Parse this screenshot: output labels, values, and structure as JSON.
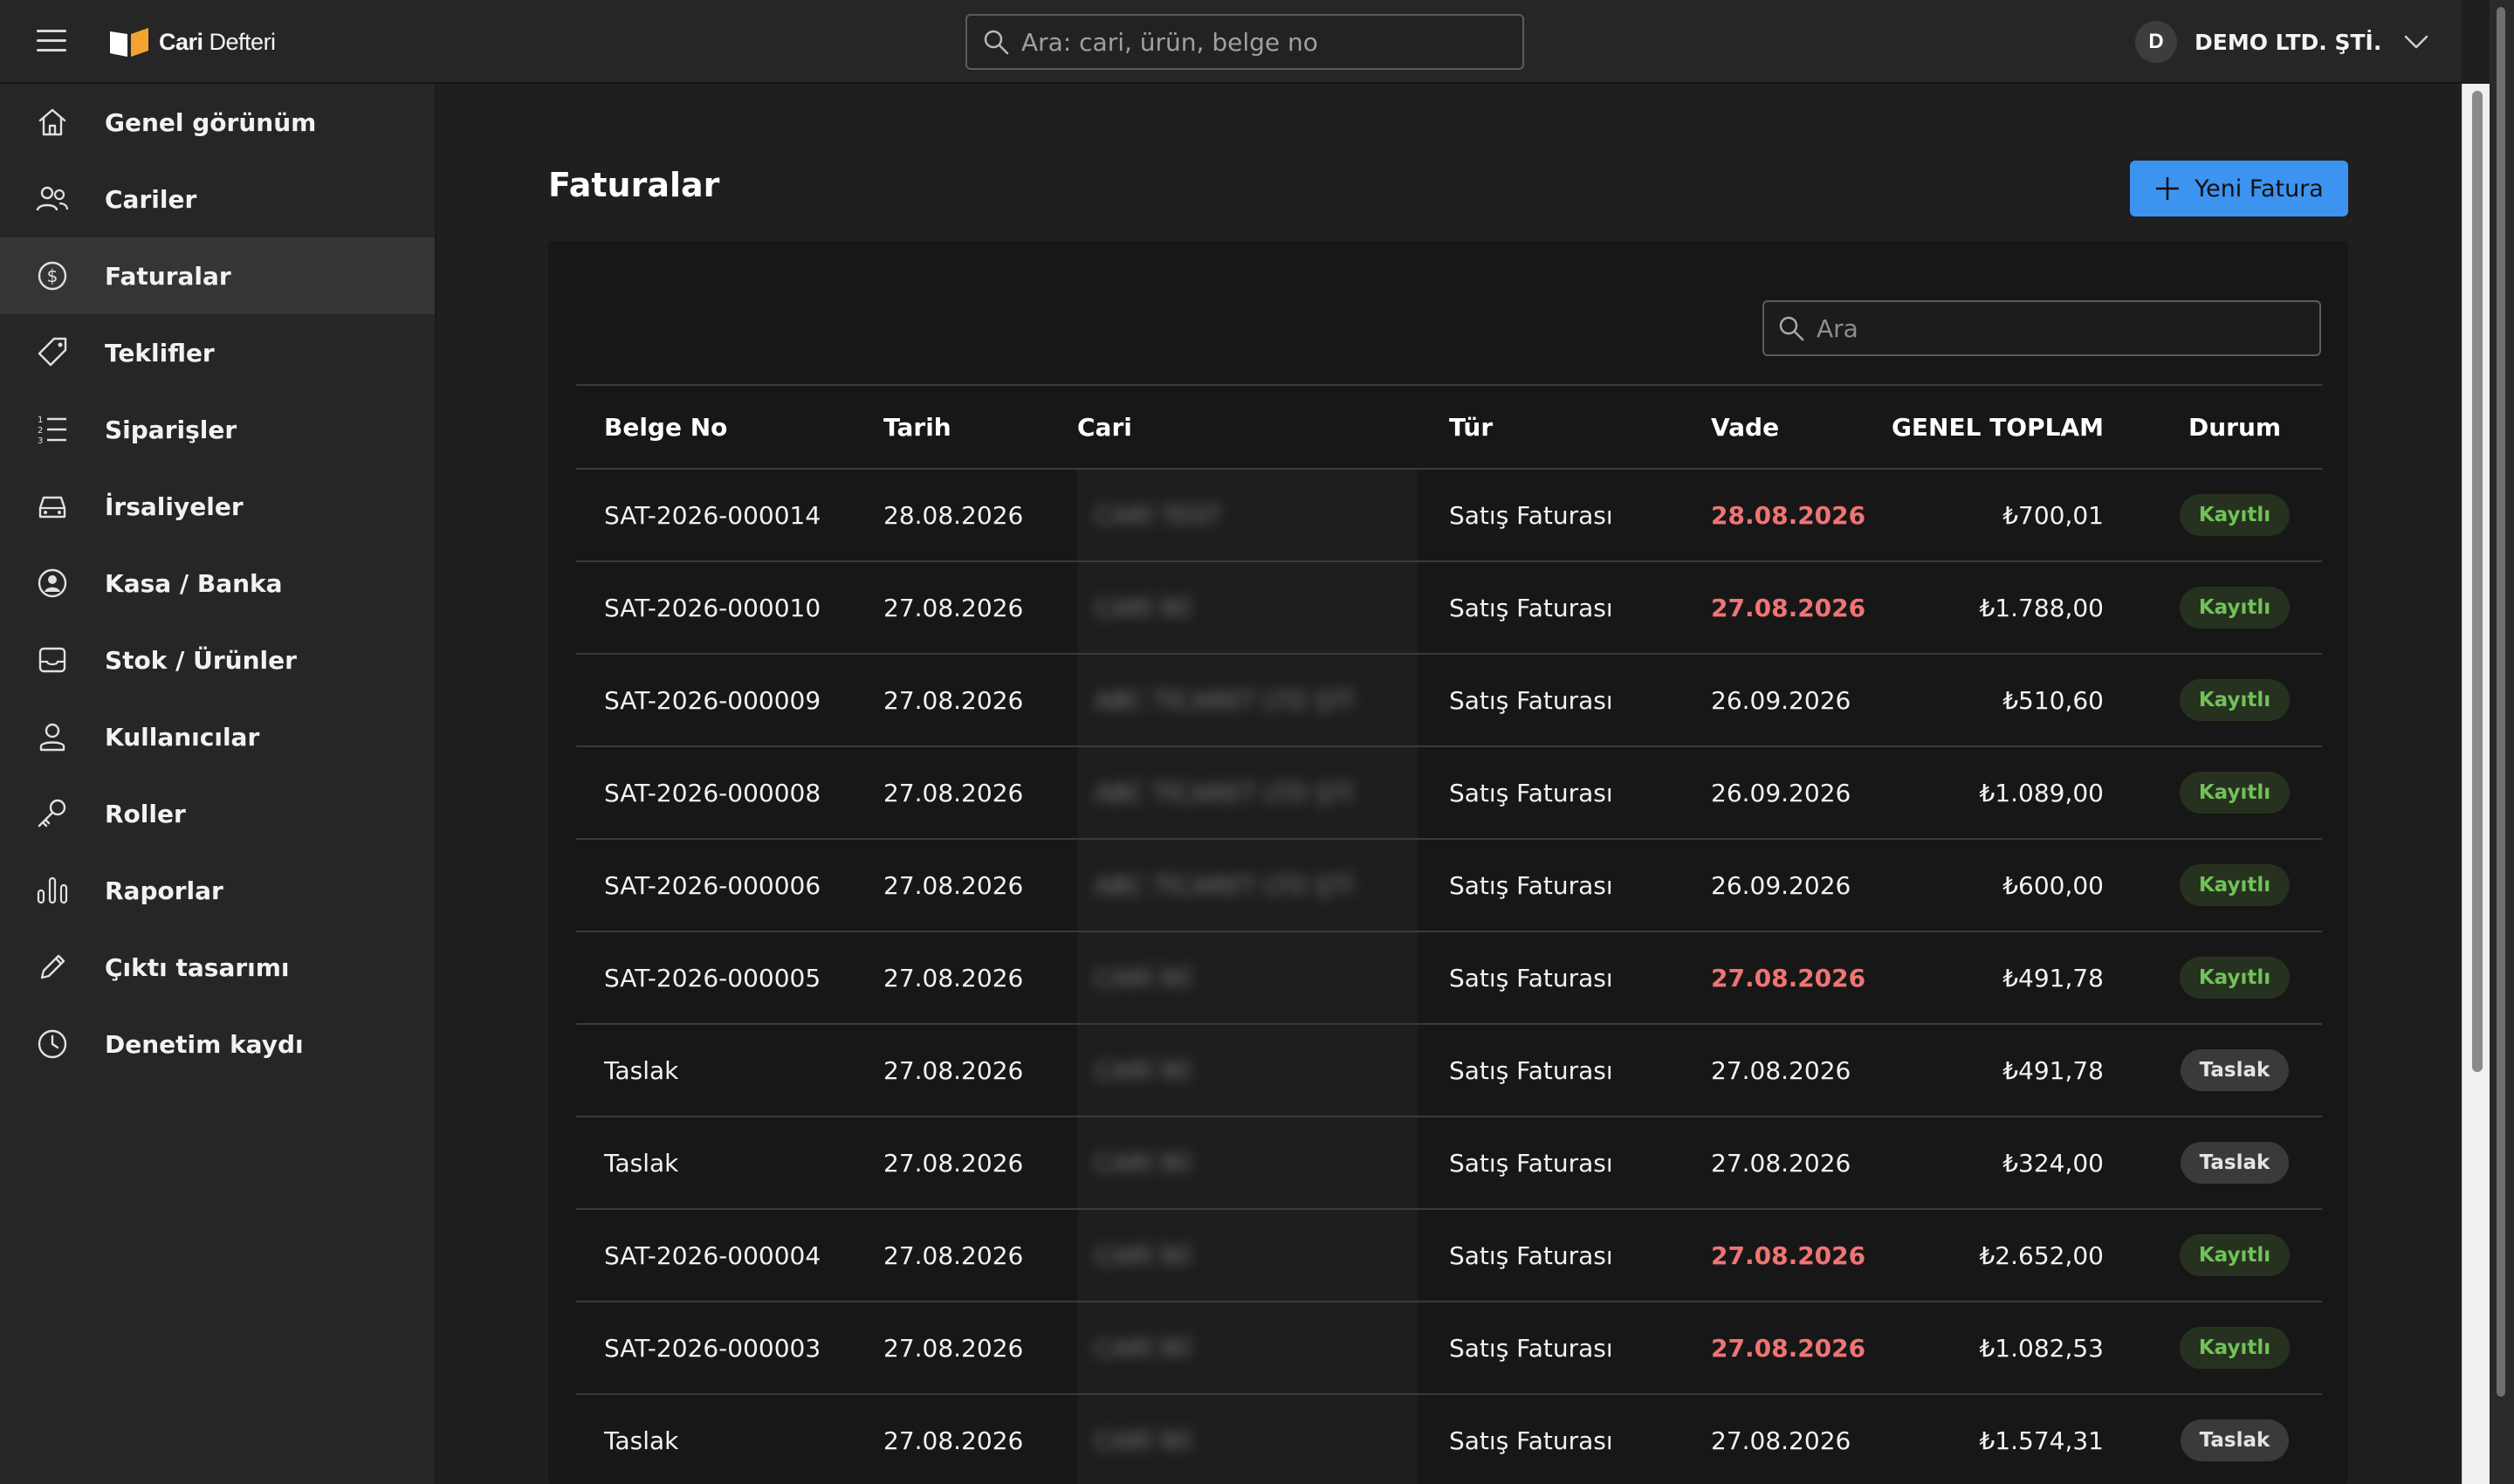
{
  "app": {
    "logo_bold": "Cari",
    "logo_rest": " Defteri",
    "search_placeholder": "Ara: cari, ürün, belge no",
    "avatar_letter": "D",
    "company": "DEMO LTD. ŞTİ."
  },
  "sidebar": {
    "items": [
      {
        "label": "Genel görünüm",
        "icon": "home-icon"
      },
      {
        "label": "Cariler",
        "icon": "users-icon"
      },
      {
        "label": "Faturalar",
        "icon": "dollar-circle-icon",
        "active": true
      },
      {
        "label": "Teklifler",
        "icon": "tag-icon"
      },
      {
        "label": "Siparişler",
        "icon": "ordered-list-icon"
      },
      {
        "label": "İrsaliyeler",
        "icon": "car-icon"
      },
      {
        "label": "Kasa / Banka",
        "icon": "user-circle-icon"
      },
      {
        "label": "Stok / Ürünler",
        "icon": "inbox-icon"
      },
      {
        "label": "Kullanıcılar",
        "icon": "user-icon"
      },
      {
        "label": "Roller",
        "icon": "key-icon"
      },
      {
        "label": "Raporlar",
        "icon": "bar-chart-icon"
      },
      {
        "label": "Çıktı tasarımı",
        "icon": "pencil-icon"
      },
      {
        "label": "Denetim kaydı",
        "icon": "clock-icon"
      }
    ]
  },
  "page": {
    "title": "Faturalar",
    "new_button": "Yeni Fatura",
    "table_search_placeholder": "Ara"
  },
  "table": {
    "headers": {
      "no": "Belge No",
      "date": "Tarih",
      "cari": "Cari",
      "type": "Tür",
      "due": "Vade",
      "total": "GENEL TOPLAM",
      "status": "Durum"
    },
    "rows": [
      {
        "no": "SAT-2026-000014",
        "date": "28.08.2026",
        "cari": "CARİ TEST",
        "type": "Satış Faturası",
        "due": "28.08.2026",
        "overdue": true,
        "total": "₺700,01",
        "status": "Kayıtlı",
        "saved": true
      },
      {
        "no": "SAT-2026-000010",
        "date": "27.08.2026",
        "cari": "CARİ İKİ",
        "type": "Satış Faturası",
        "due": "27.08.2026",
        "overdue": true,
        "total": "₺1.788,00",
        "status": "Kayıtlı",
        "saved": true
      },
      {
        "no": "SAT-2026-000009",
        "date": "27.08.2026",
        "cari": "ABC TİCARET LTD ŞTİ",
        "type": "Satış Faturası",
        "due": "26.09.2026",
        "overdue": false,
        "total": "₺510,60",
        "status": "Kayıtlı",
        "saved": true
      },
      {
        "no": "SAT-2026-000008",
        "date": "27.08.2026",
        "cari": "ABC TİCARET LTD ŞTİ",
        "type": "Satış Faturası",
        "due": "26.09.2026",
        "overdue": false,
        "total": "₺1.089,00",
        "status": "Kayıtlı",
        "saved": true
      },
      {
        "no": "SAT-2026-000006",
        "date": "27.08.2026",
        "cari": "ABC TİCARET LTD ŞTİ",
        "type": "Satış Faturası",
        "due": "26.09.2026",
        "overdue": false,
        "total": "₺600,00",
        "status": "Kayıtlı",
        "saved": true
      },
      {
        "no": "SAT-2026-000005",
        "date": "27.08.2026",
        "cari": "CARİ İKİ",
        "type": "Satış Faturası",
        "due": "27.08.2026",
        "overdue": true,
        "total": "₺491,78",
        "status": "Kayıtlı",
        "saved": true
      },
      {
        "no": "Taslak",
        "date": "27.08.2026",
        "cari": "CARİ İKİ",
        "type": "Satış Faturası",
        "due": "27.08.2026",
        "overdue": false,
        "total": "₺491,78",
        "status": "Taslak",
        "saved": false
      },
      {
        "no": "Taslak",
        "date": "27.08.2026",
        "cari": "CARİ İKİ",
        "type": "Satış Faturası",
        "due": "27.08.2026",
        "overdue": false,
        "total": "₺324,00",
        "status": "Taslak",
        "saved": false
      },
      {
        "no": "SAT-2026-000004",
        "date": "27.08.2026",
        "cari": "CARİ İKİ",
        "type": "Satış Faturası",
        "due": "27.08.2026",
        "overdue": true,
        "total": "₺2.652,00",
        "status": "Kayıtlı",
        "saved": true
      },
      {
        "no": "SAT-2026-000003",
        "date": "27.08.2026",
        "cari": "CARİ İKİ",
        "type": "Satış Faturası",
        "due": "27.08.2026",
        "overdue": true,
        "total": "₺1.082,53",
        "status": "Kayıtlı",
        "saved": true
      },
      {
        "no": "Taslak",
        "date": "27.08.2026",
        "cari": "CARİ İKİ",
        "type": "Satış Faturası",
        "due": "27.08.2026",
        "overdue": false,
        "total": "₺1.574,31",
        "status": "Taslak",
        "saved": false
      }
    ]
  },
  "colors": {
    "accent": "#3d93f0",
    "overdue": "#f07474",
    "saved_text": "#72c15a",
    "saved_bg": "#26321f",
    "draft_bg": "#3a3a3a"
  }
}
